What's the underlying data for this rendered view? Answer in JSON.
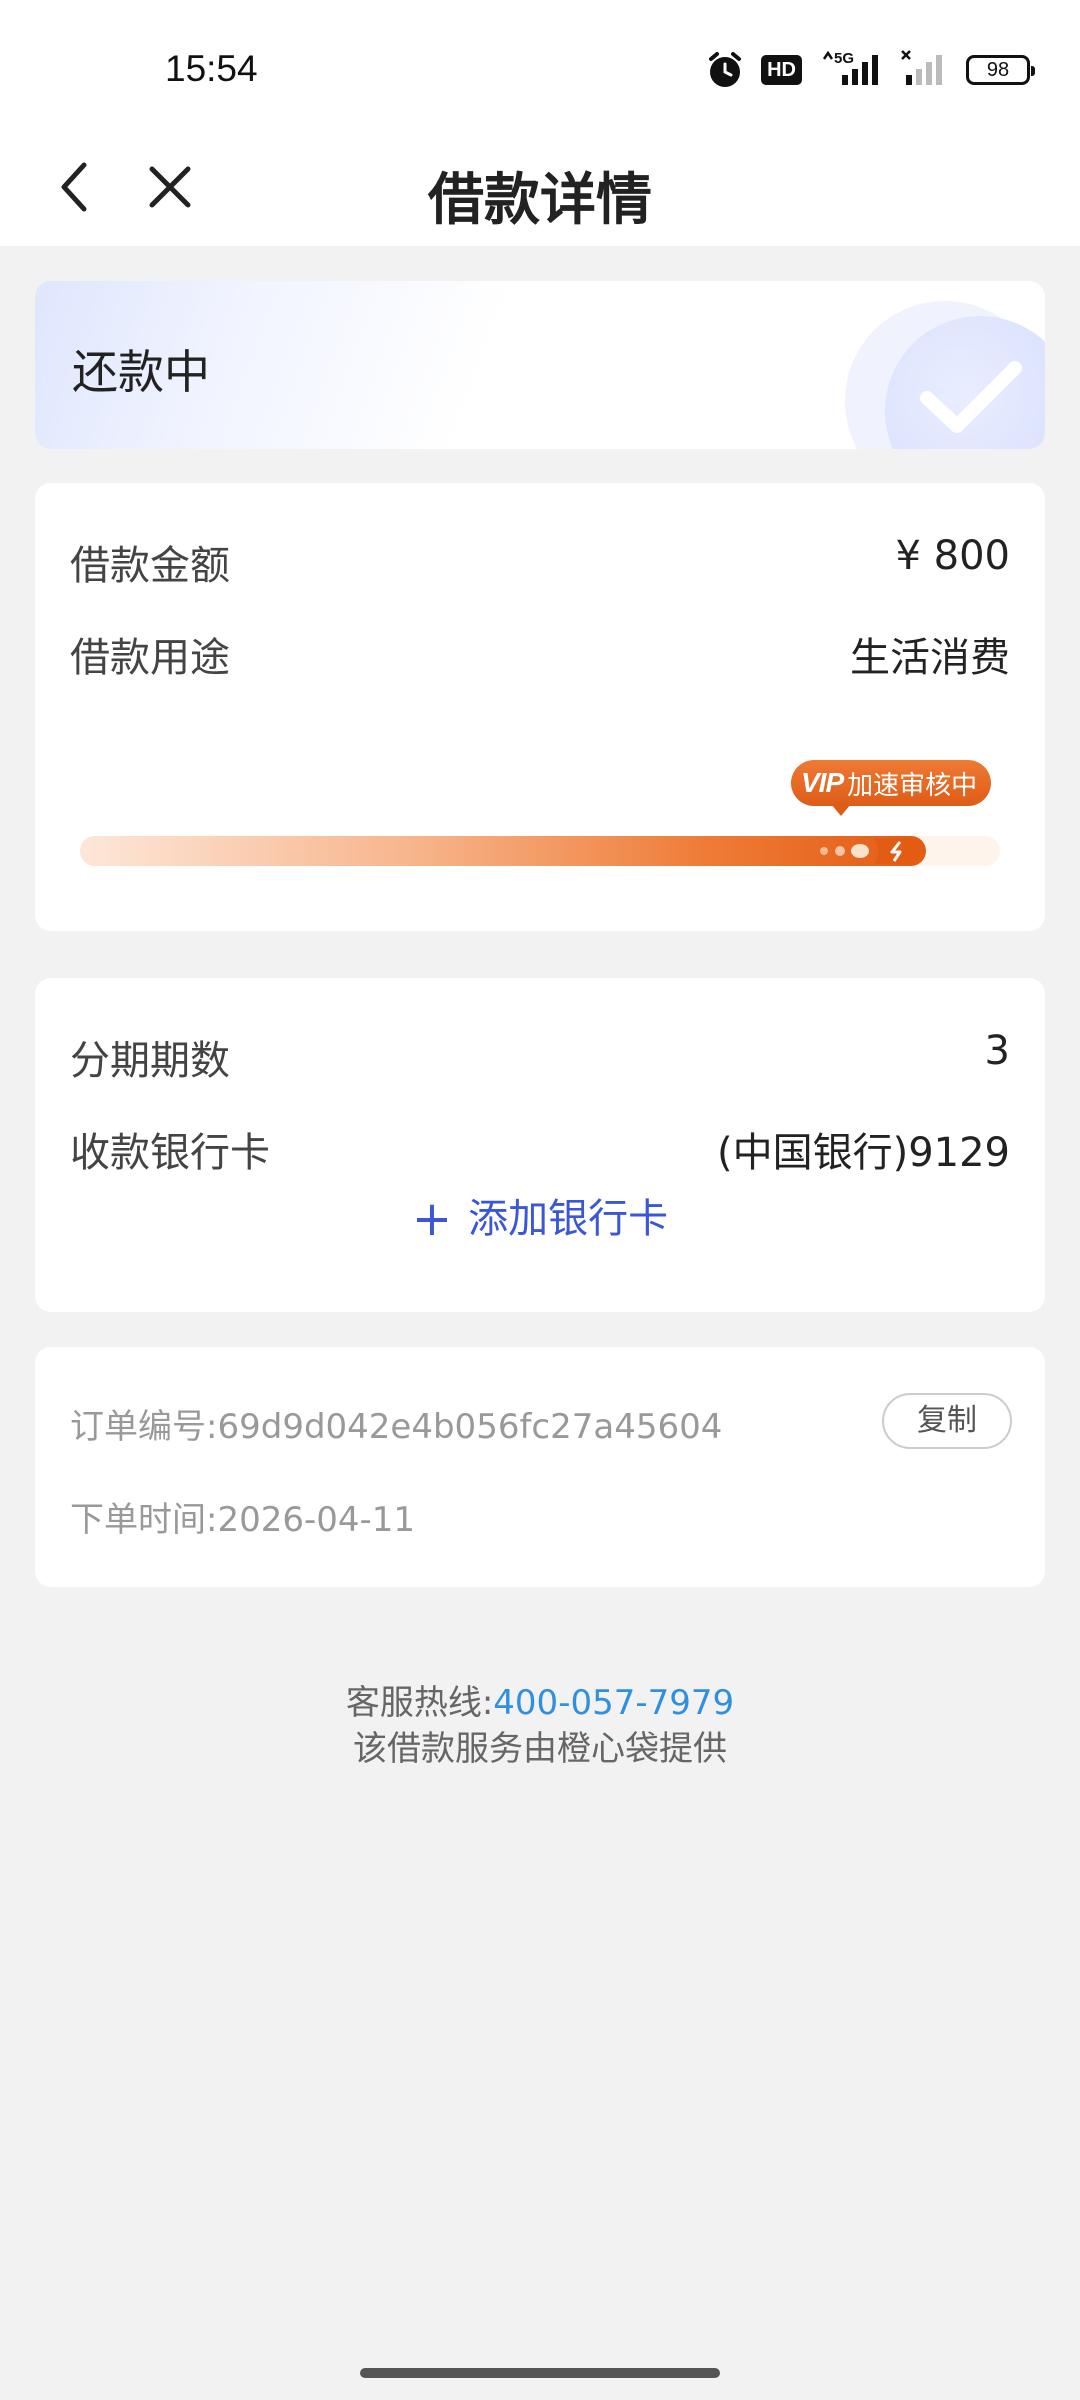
{
  "status_bar": {
    "time": "15:54",
    "hd_label": "HD",
    "network_label": "5G",
    "battery": "98",
    "icons": [
      "alarm-icon",
      "hd-icon",
      "5g-signal-icon",
      "signal-icon",
      "battery-icon"
    ]
  },
  "nav": {
    "title": "借款详情",
    "back_icon": "chevron-left-icon",
    "close_icon": "close-icon"
  },
  "status_card": {
    "status": "还款中",
    "badge_icon": "check-icon"
  },
  "loan": {
    "amount_label": "借款金额",
    "amount_value": "¥ 800",
    "purpose_label": "借款用途",
    "purpose_value": "生活消费",
    "vip_mark": "VIP",
    "vip_text": "加速审核中",
    "progress": 0.92,
    "colors": {
      "accent": "#e35c14",
      "light": "#fde7d9"
    }
  },
  "installment": {
    "periods_label": "分期期数",
    "periods_value": "3",
    "bank_label": "收款银行卡",
    "bank_value": "(中国银行)9129",
    "add_card_label": "添加银行卡",
    "add_color": "#3b56d6"
  },
  "order": {
    "number_label": "订单编号:",
    "number_value": "69d9d042e4b056fc27a45604",
    "copy_label": "复制",
    "time_label": "下单时间:",
    "time_value": "2026-04-11"
  },
  "footer": {
    "hotline_label": "客服热线:",
    "hotline_value": "400-057-7979",
    "provider_text": "该借款服务由橙心袋提供",
    "link_color": "#2f8fe0"
  }
}
